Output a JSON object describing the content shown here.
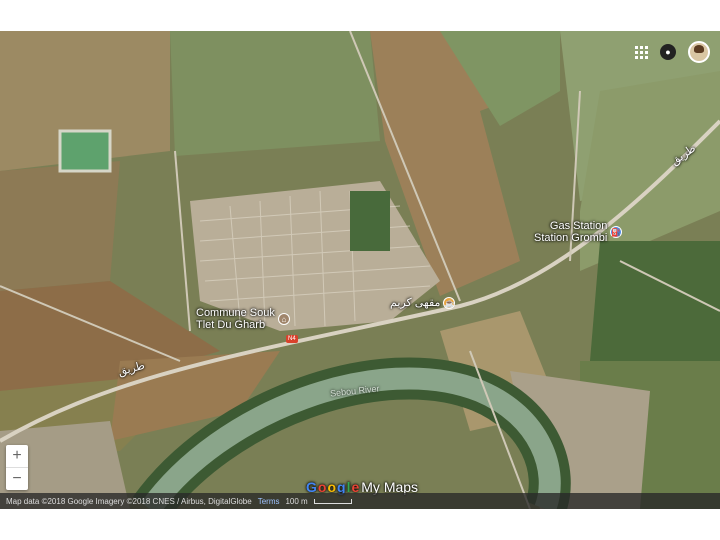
{
  "map": {
    "labels": {
      "gas_station_en": "Gas Station",
      "gas_station_local": "Station Grombi",
      "commune_line1": "Commune Souk",
      "commune_line2": "Tlet Du Gharb",
      "arabic_poi": "مقهى كريم",
      "road_label_1": "طريق",
      "road_label_2": "طريق",
      "river_label": "Sebou River",
      "route_shield": "N4"
    },
    "brand": {
      "text": "Google My Maps",
      "letters": [
        "G",
        "o",
        "o",
        "g",
        "l",
        "e"
      ],
      "rest": "My Maps"
    },
    "attribution": {
      "text": "Map data ©2018 Google Imagery ©2018 CNES / Airbus, DigitalGlobe",
      "terms": "Terms",
      "scale": "100 m"
    },
    "controls": {
      "zoom_in": "+",
      "zoom_out": "−"
    },
    "icons": {
      "apps": "apps-grid-icon",
      "notifications": "bell-icon",
      "profile": "avatar",
      "gas": "gas-pump-icon",
      "commune": "landmark-icon",
      "cafe": "cafe-icon"
    },
    "colors": {
      "gas_pin": "#4a86e8",
      "commune_pin": "#a0856b",
      "cafe_pin": "#e8a33d",
      "river": "#8aa58a"
    }
  }
}
